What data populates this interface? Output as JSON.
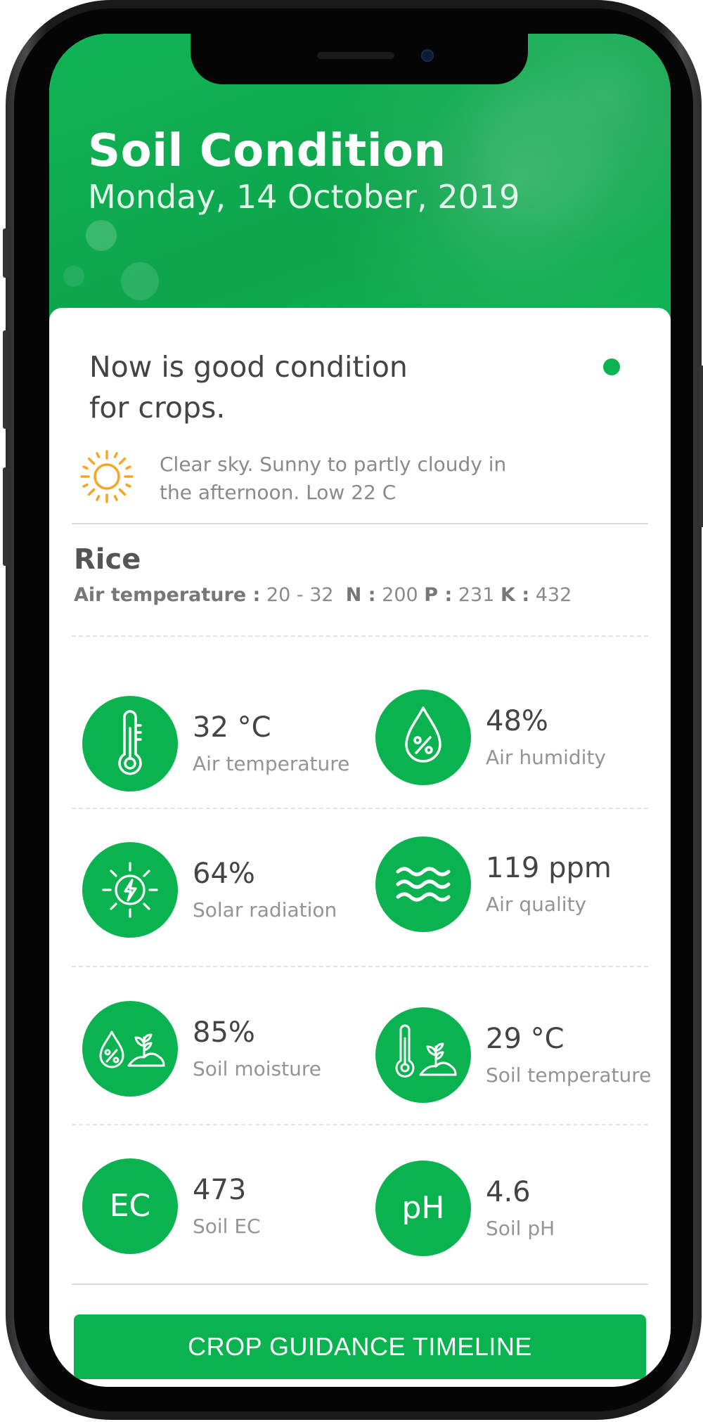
{
  "header": {
    "title": "Soil Condition",
    "date": "Monday, 14 October, 2019"
  },
  "condition": {
    "message": "Now is good condition for crops.",
    "status_color": "#0bb350",
    "weather_icon": "sun-icon",
    "weather_text": "Clear sky. Sunny to partly cloudy in the afternoon. Low 22 C"
  },
  "crop": {
    "name": "Rice",
    "air_temp_label": "Air temperature :",
    "air_temp_value": "20 - 32",
    "n_label": "N :",
    "n_value": "200",
    "p_label": "P :",
    "p_value": "231",
    "k_label": "K :",
    "k_value": "432"
  },
  "metrics": [
    {
      "icon": "thermometer-icon",
      "value": "32 °C",
      "label": "Air temperature"
    },
    {
      "icon": "humidity-drop-icon",
      "value": "48%",
      "label": "Air humidity"
    },
    {
      "icon": "solar-radiation-icon",
      "value": "64%",
      "label": "Solar radiation"
    },
    {
      "icon": "air-waves-icon",
      "value": "119 ppm",
      "label": "Air quality"
    },
    {
      "icon": "soil-moisture-icon",
      "value": "85%",
      "label": "Soil moisture"
    },
    {
      "icon": "soil-temperature-icon",
      "value": "29 °C",
      "label": "Soil temperature"
    },
    {
      "icon": "ec-icon",
      "icon_text": "EC",
      "value": "473",
      "label": "Soil EC"
    },
    {
      "icon": "ph-icon",
      "icon_text": "pH",
      "value": "4.6",
      "label": "Soil pH"
    }
  ],
  "cta": {
    "label": "CROP GUIDANCE TIMELINE",
    "color": "#0bb350"
  }
}
